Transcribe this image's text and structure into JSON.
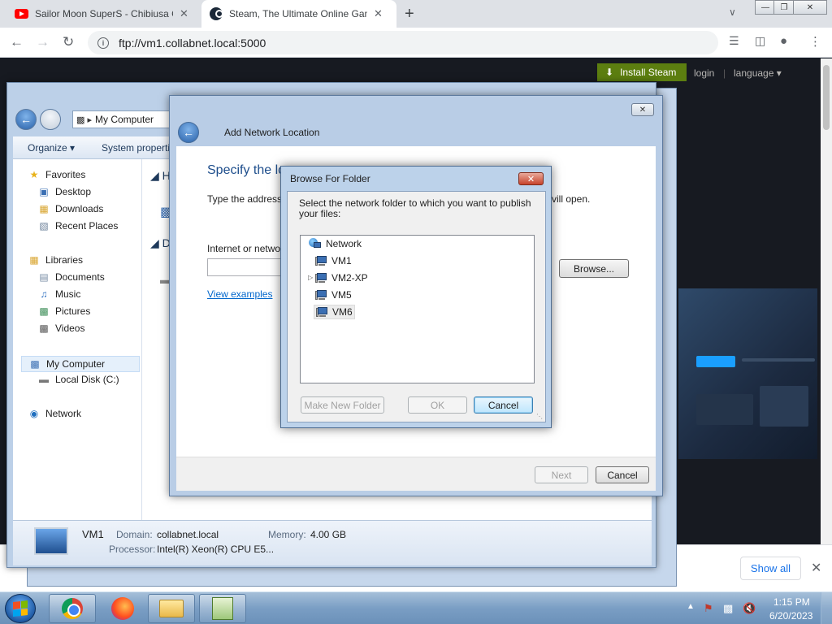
{
  "browser": {
    "tabs": [
      {
        "title": "Sailor Moon SuperS - Chibiusa G",
        "icon": "youtube-icon",
        "close": "✕"
      },
      {
        "title": "Steam, The Ultimate Online Gam",
        "icon": "steam-icon",
        "close": "✕"
      }
    ],
    "new_tab": "+",
    "address": "ftp://vm1.collabnet.local:5000"
  },
  "steam": {
    "install_label": "Install Steam",
    "login_label": "login",
    "separator": "|",
    "language_label": "language ▾"
  },
  "downloads": {
    "show_all_label": "Show all",
    "close": "✕"
  },
  "explorer": {
    "address": "My Computer",
    "toolbar": {
      "organize": "Organize ▾",
      "system_properties": "System properti"
    },
    "nav": {
      "favorites": "Favorites",
      "desktop": "Desktop",
      "downloads": "Downloads",
      "recent_places": "Recent Places",
      "libraries": "Libraries",
      "documents": "Documents",
      "music": "Music",
      "pictures": "Pictures",
      "videos": "Videos",
      "my_computer": "My Computer",
      "local_disk": "Local Disk (C:)",
      "network": "Network"
    },
    "content_partial": {
      "h": "H",
      "d": "D"
    },
    "details": {
      "name": "VM1",
      "domain_label": "Domain:",
      "domain_value": "collabnet.local",
      "memory_label": "Memory:",
      "memory_value": "4.00 GB",
      "processor_label": "Processor:",
      "processor_value": "Intel(R) Xeon(R) CPU E5..."
    }
  },
  "wizard": {
    "title": "Add Network Location",
    "heading": "Specify the lo",
    "description": "Type the address",
    "description_end": "vill open.",
    "internet_label": "Internet or netwo",
    "examples_link": "View examples",
    "browse_label": "Browse...",
    "next_label": "Next",
    "cancel_label": "Cancel"
  },
  "browse_dialog": {
    "title": "Browse For Folder",
    "description": "Select the network folder to which you want to publish your files:",
    "tree": [
      {
        "label": "Network",
        "level": 0,
        "expandable": false,
        "selected": false
      },
      {
        "label": "VM1",
        "level": 1,
        "expandable": false,
        "selected": false
      },
      {
        "label": "VM2-XP",
        "level": 1,
        "expandable": true,
        "selected": false
      },
      {
        "label": "VM5",
        "level": 1,
        "expandable": false,
        "selected": false
      },
      {
        "label": "VM6",
        "level": 1,
        "expandable": false,
        "selected": true
      }
    ],
    "new_folder_label": "Make New Folder",
    "ok_label": "OK",
    "cancel_label": "Cancel"
  },
  "taskbar": {
    "clock_time": "1:15 PM",
    "clock_date": "6/20/2023"
  },
  "colors": {
    "steam_green": "#5c7e10",
    "win7_accent": "#1e4e8c",
    "link_blue": "#0066cc"
  }
}
